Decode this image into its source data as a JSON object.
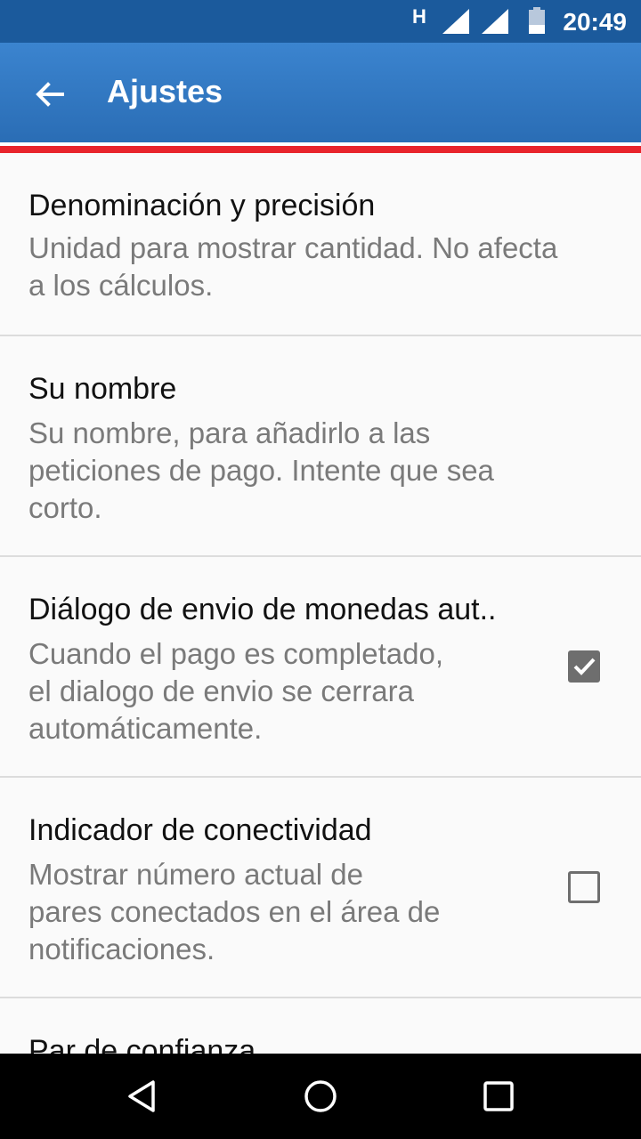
{
  "status_bar": {
    "network": "H",
    "time": "20:49",
    "icons": [
      "signal-icon",
      "signal-icon",
      "battery-icon"
    ]
  },
  "toolbar": {
    "title": "Ajustes",
    "back_icon": "arrow-left-icon"
  },
  "accent": {
    "white": "#ffffff",
    "red": "#e8242c",
    "bar": "#2a6db5"
  },
  "preferences": [
    {
      "title": "Denominación y precisión",
      "summary_lines": [
        "Unidad para mostrar cantidad. No afecta",
        "a los cálculos."
      ]
    },
    {
      "title": "Su nombre",
      "summary_lines": [
        "Su nombre, para añadirlo a las",
        "peticiones de pago. Intente que sea",
        "corto."
      ]
    },
    {
      "title": "Diálogo de envio de monedas aut..",
      "summary_lines": [
        "Cuando el pago es completado,",
        "el dialogo de envio se cerrara",
        "automáticamente."
      ],
      "checked": true
    },
    {
      "title": "Indicador de conectividad",
      "summary_lines": [
        "Mostrar número actual de",
        "pares conectados en el área de",
        "notificaciones."
      ],
      "checked": false
    },
    {
      "title": "Par de confianza"
    }
  ],
  "nav_bar": {
    "icons": [
      "back-triangle-icon",
      "home-circle-icon",
      "recents-square-icon"
    ]
  }
}
